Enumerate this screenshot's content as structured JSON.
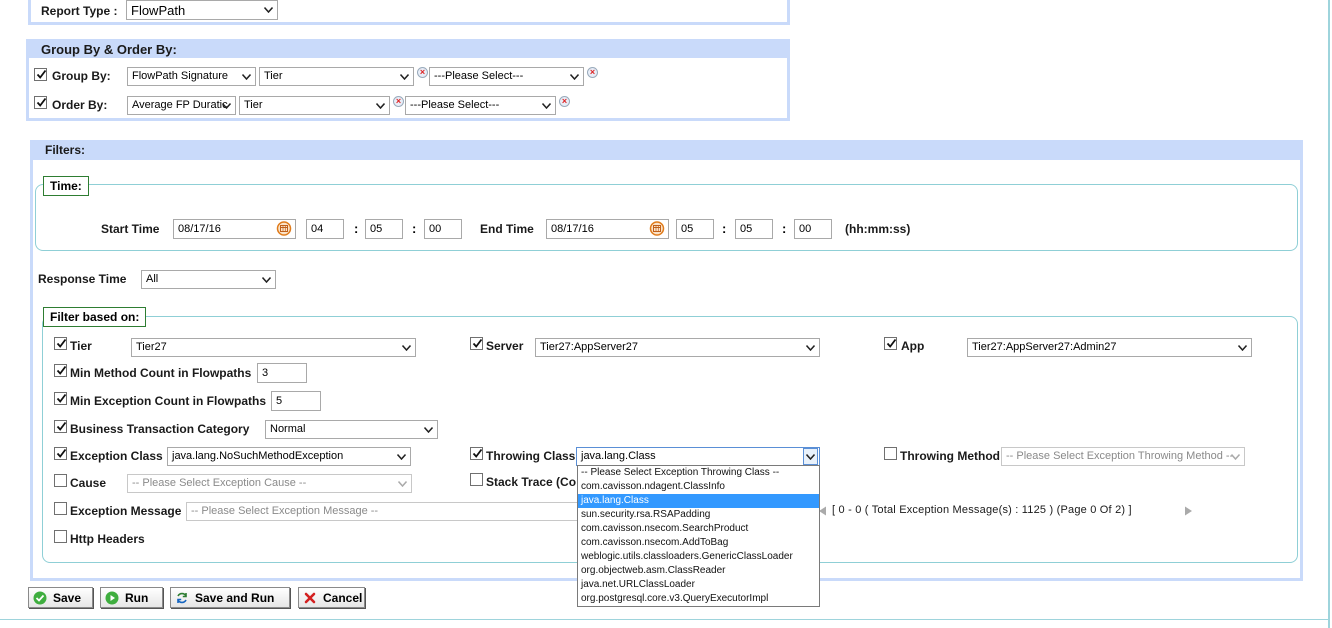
{
  "report_type": {
    "label": "Report Type :",
    "value": "FlowPath"
  },
  "group_order": {
    "title": "Group By & Order By:",
    "group_by": {
      "label": "Group By:",
      "checked": true,
      "sel1": "FlowPath Signature",
      "sel2": "Tier",
      "sel3": "---Please Select---"
    },
    "order_by": {
      "label": "Order By:",
      "checked": true,
      "sel1": "Average FP Duratic",
      "sel2": "Tier",
      "sel3": "---Please Select---"
    }
  },
  "filters": {
    "title": "Filters:",
    "time": {
      "legend": "Time:",
      "start_label": "Start Time",
      "start_date": "08/17/16",
      "start_hh": "04",
      "start_mm": "05",
      "start_ss": "00",
      "end_label": "End Time",
      "end_date": "08/17/16",
      "end_hh": "05",
      "end_mm": "05",
      "end_ss": "00",
      "format_hint": "(hh:mm:ss)",
      "colon": ":"
    },
    "response_time": {
      "label": "Response Time",
      "value": "All"
    },
    "filter_based_on": {
      "legend": "Filter based on:",
      "tier": {
        "label": "Tier",
        "value": "Tier27",
        "checked": true
      },
      "server": {
        "label": "Server",
        "value": "Tier27:AppServer27",
        "checked": true
      },
      "app": {
        "label": "App",
        "value": "Tier27:AppServer27:Admin27",
        "checked": true
      },
      "min_method": {
        "label": "Min Method Count in Flowpaths",
        "value": "3",
        "checked": true
      },
      "min_exception": {
        "label": "Min Exception Count in Flowpaths",
        "value": "5",
        "checked": true
      },
      "btc": {
        "label": "Business Transaction Category",
        "value": "Normal",
        "checked": true
      },
      "exception_class": {
        "label": "Exception Class",
        "value": "java.lang.NoSuchMethodException",
        "checked": true
      },
      "throwing_class": {
        "label": "Throwing Class",
        "value": "java.lang.Class",
        "checked": true
      },
      "throwing_method": {
        "label": "Throwing Method",
        "placeholder": "-- Please Select Exception Throwing Method --",
        "checked": false
      },
      "cause": {
        "label": "Cause",
        "placeholder": "-- Please Select Exception Cause --",
        "checked": false
      },
      "stack_trace": {
        "label": "Stack Trace (Co",
        "checked": false
      },
      "exception_message": {
        "label": "Exception Message",
        "placeholder": "-- Please Select Exception Message --",
        "checked": false
      },
      "pager_text": "[ 0 - 0 ( Total Exception Message(s) : 1125 ) (Page 0 Of 2) ]",
      "http_headers": {
        "label": "Http Headers",
        "checked": false
      }
    }
  },
  "throwing_class_options": [
    "-- Please Select Exception Throwing Class --",
    "com.cavisson.ndagent.ClassInfo",
    "java.lang.Class",
    "sun.security.rsa.RSAPadding",
    "com.cavisson.nsecom.SearchProduct",
    "com.cavisson.nsecom.AddToBag",
    "weblogic.utils.classloaders.GenericClassLoader",
    "org.objectweb.asm.ClassReader",
    "java.net.URLClassLoader",
    "org.postgresql.core.v3.QueryExecutorImpl"
  ],
  "throwing_class_selected_index": 2,
  "buttons": {
    "save": "Save",
    "run": "Run",
    "save_and_run": "Save and Run",
    "cancel": "Cancel"
  },
  "colors": {
    "panel_header": "#c9dafa",
    "panel_border": "#c9dafa",
    "fieldset_border": "#8fcfd6",
    "legend_border": "#2e7d32",
    "highlight": "#3399ff"
  }
}
